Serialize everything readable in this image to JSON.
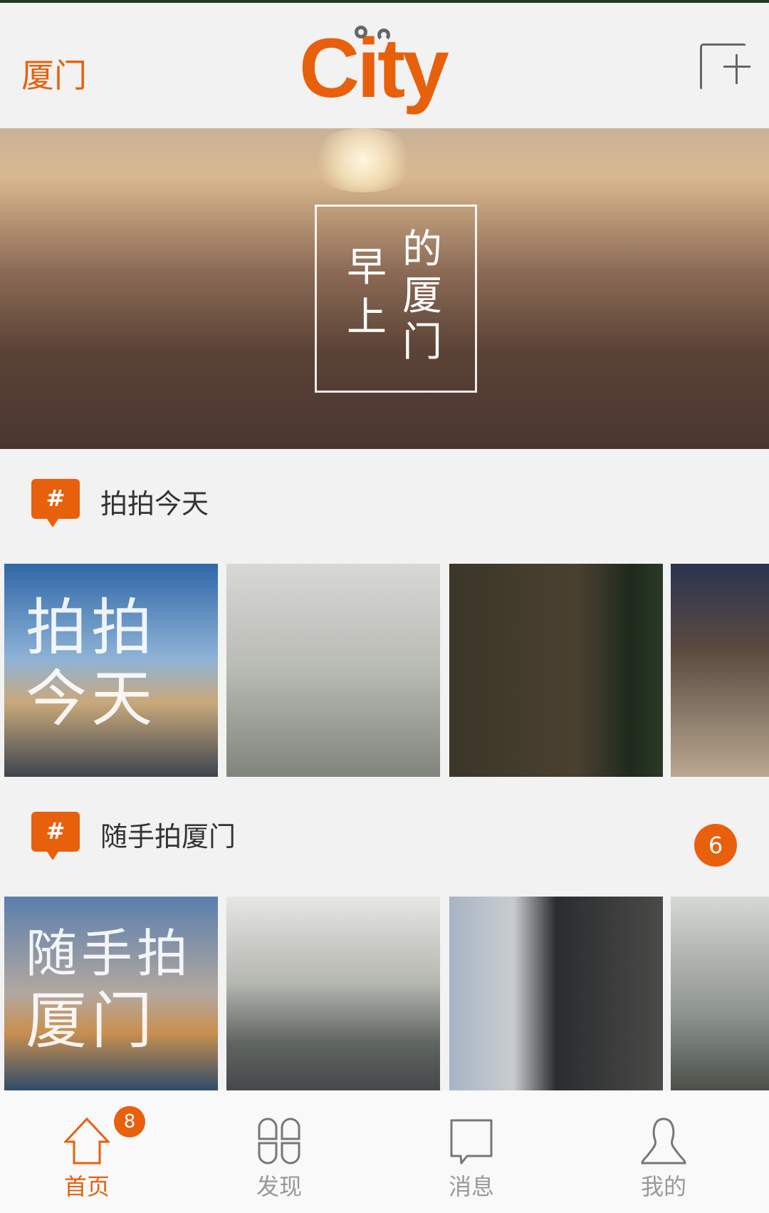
{
  "header": {
    "city": "厦门",
    "logo": "City",
    "add_icon": "add-post-icon"
  },
  "banner": {
    "chars": [
      "早",
      "上",
      "的",
      "厦",
      "门"
    ]
  },
  "sections": [
    {
      "title": "拍拍今天",
      "icon": "hash-icon",
      "cover_text": [
        "拍拍",
        "今天"
      ]
    },
    {
      "title": "随手拍厦门",
      "icon": "hash-icon",
      "count": "6",
      "cover_text": [
        "随手拍",
        "厦门"
      ]
    }
  ],
  "nav": [
    {
      "label": "首页",
      "icon": "home-icon",
      "badge": "8",
      "active": true
    },
    {
      "label": "发现",
      "icon": "discover-grid-icon"
    },
    {
      "label": "消息",
      "icon": "message-bubble-icon"
    },
    {
      "label": "我的",
      "icon": "profile-person-icon"
    }
  ],
  "colors": {
    "accent": "#e8600c",
    "inactive": "#999999"
  }
}
